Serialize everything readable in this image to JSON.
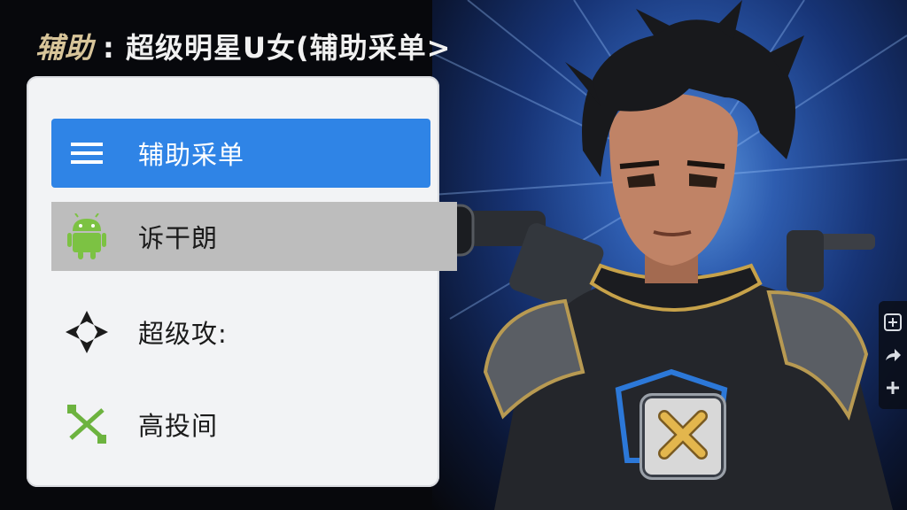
{
  "title": {
    "prefix": "辅助",
    "text": ": 超级明星U女(辅助采单>"
  },
  "menu": {
    "items": [
      {
        "label": "辅助采单",
        "icon": "hamburger-icon"
      },
      {
        "label": "诉干朗",
        "icon": "android-icon"
      },
      {
        "label": "超级攻:",
        "icon": "diamond-cross-icon"
      },
      {
        "label": "高投间",
        "icon": "green-arrows-icon"
      }
    ]
  },
  "colors": {
    "accent": "#2f84e6",
    "selected_row": "#bdbdbd",
    "panel_bg": "#f2f3f5"
  },
  "side_tools": {
    "icons": [
      "plus-square-icon",
      "share-arrow-icon",
      "plus-icon"
    ]
  },
  "close_button": {
    "icon": "close-x-icon"
  }
}
